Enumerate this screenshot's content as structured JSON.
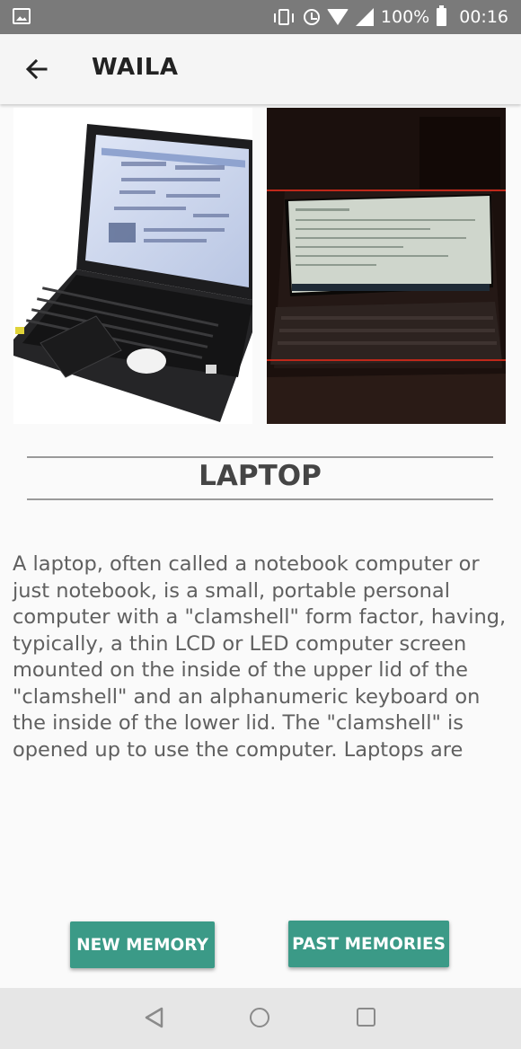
{
  "status_bar": {
    "battery_text": "100%",
    "time": "00:16",
    "icons": [
      "image-icon",
      "vibrate-icon",
      "alarm-icon",
      "wifi-icon",
      "cell-signal-icon",
      "battery-icon"
    ]
  },
  "app_bar": {
    "title": "WAILA",
    "back_icon": "arrow-back-icon"
  },
  "item": {
    "title": "LAPTOP",
    "description": "A laptop, often called a notebook computer or just notebook, is a small, portable personal computer with a \"clamshell\" form factor, having, typically, a thin LCD or LED computer screen mounted on the inside of the upper lid of the \"clamshell\" and an alphanumeric keyboard on the inside of the lower lid. The \"clamshell\" is opened up to use the computer. Laptops are"
  },
  "buttons": {
    "new_memory": "NEW MEMORY",
    "past_memories": "PAST MEMORIES"
  },
  "colors": {
    "accent": "#3b9a87",
    "status_bar": "#7a7a7a",
    "app_bar": "#f5f5f5",
    "highlight_line": "#c0281a"
  },
  "nav_bar": {
    "icons": [
      "nav-back-icon",
      "nav-home-icon",
      "nav-recent-icon"
    ]
  }
}
